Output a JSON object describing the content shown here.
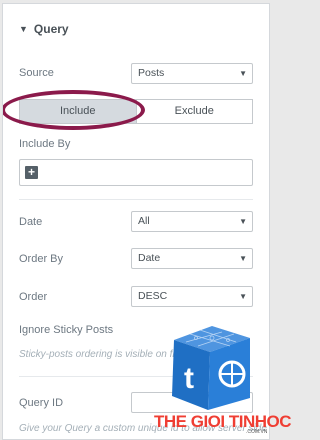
{
  "section": {
    "title": "Query"
  },
  "source": {
    "label": "Source",
    "value": "Posts"
  },
  "tabs": {
    "include": "Include",
    "exclude": "Exclude"
  },
  "include_by": {
    "label": "Include By"
  },
  "date": {
    "label": "Date",
    "value": "All"
  },
  "order_by": {
    "label": "Order By",
    "value": "Date"
  },
  "order": {
    "label": "Order",
    "value": "DESC"
  },
  "sticky": {
    "label": "Ignore Sticky Posts",
    "note": "Sticky-posts ordering is visible on frontend only"
  },
  "query_id": {
    "label": "Query ID",
    "note": "Give your Query a custom unique id to allow server side filtering"
  },
  "watermark": {
    "brand": "THE GIOI TINHOC",
    "domain": ".COM.VN"
  },
  "colors": {
    "highlight": "#8b1a4b",
    "brand_red": "#ef3e33",
    "brand_blue": "#1f6fc4"
  }
}
